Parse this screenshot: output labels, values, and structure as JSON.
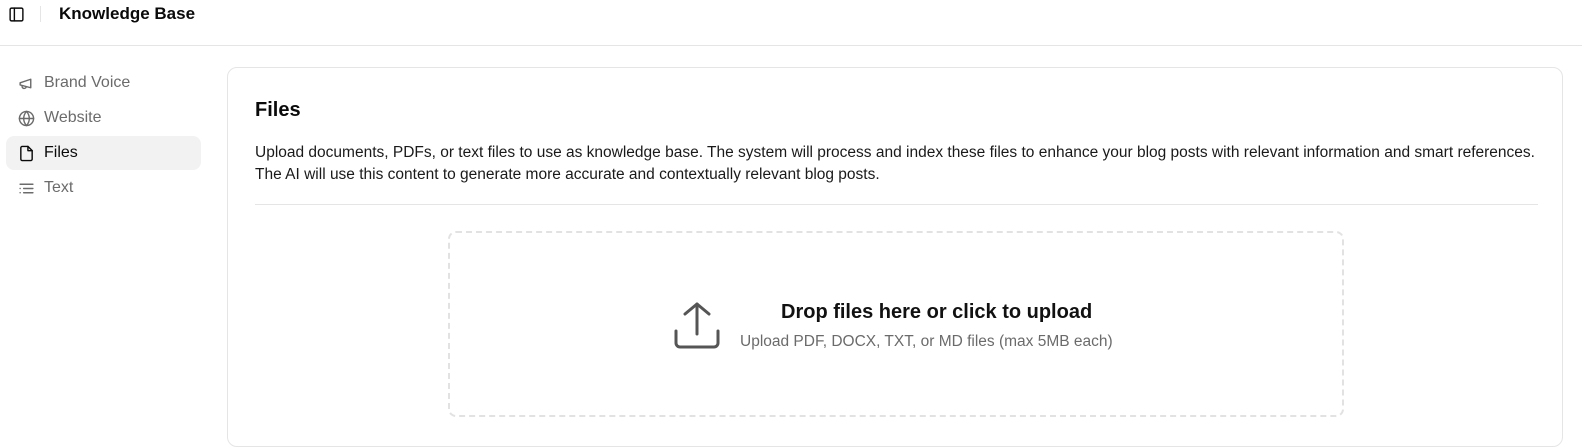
{
  "header": {
    "title": "Knowledge Base",
    "toggle_icon": "sidebar-toggle-icon"
  },
  "sidebar": {
    "items": [
      {
        "label": "Brand Voice",
        "icon": "megaphone-icon",
        "active": false
      },
      {
        "label": "Website",
        "icon": "globe-icon",
        "active": false
      },
      {
        "label": "Files",
        "icon": "file-icon",
        "active": true
      },
      {
        "label": "Text",
        "icon": "text-icon",
        "active": false
      }
    ]
  },
  "main": {
    "title": "Files",
    "description": "Upload documents, PDFs, or text files to use as knowledge base. The system will process and index these files to enhance your blog posts with relevant information and smart references. The AI will use this content to generate more accurate and contextually relevant blog posts.",
    "dropzone": {
      "title": "Drop files here or click to upload",
      "subtitle": "Upload PDF, DOCX, TXT, or MD files (max 5MB each)",
      "icon": "upload-icon"
    }
  },
  "colors": {
    "muted_text": "#6b6b6b",
    "active_bg": "#f2f2f2",
    "border": "#e5e5e5"
  }
}
